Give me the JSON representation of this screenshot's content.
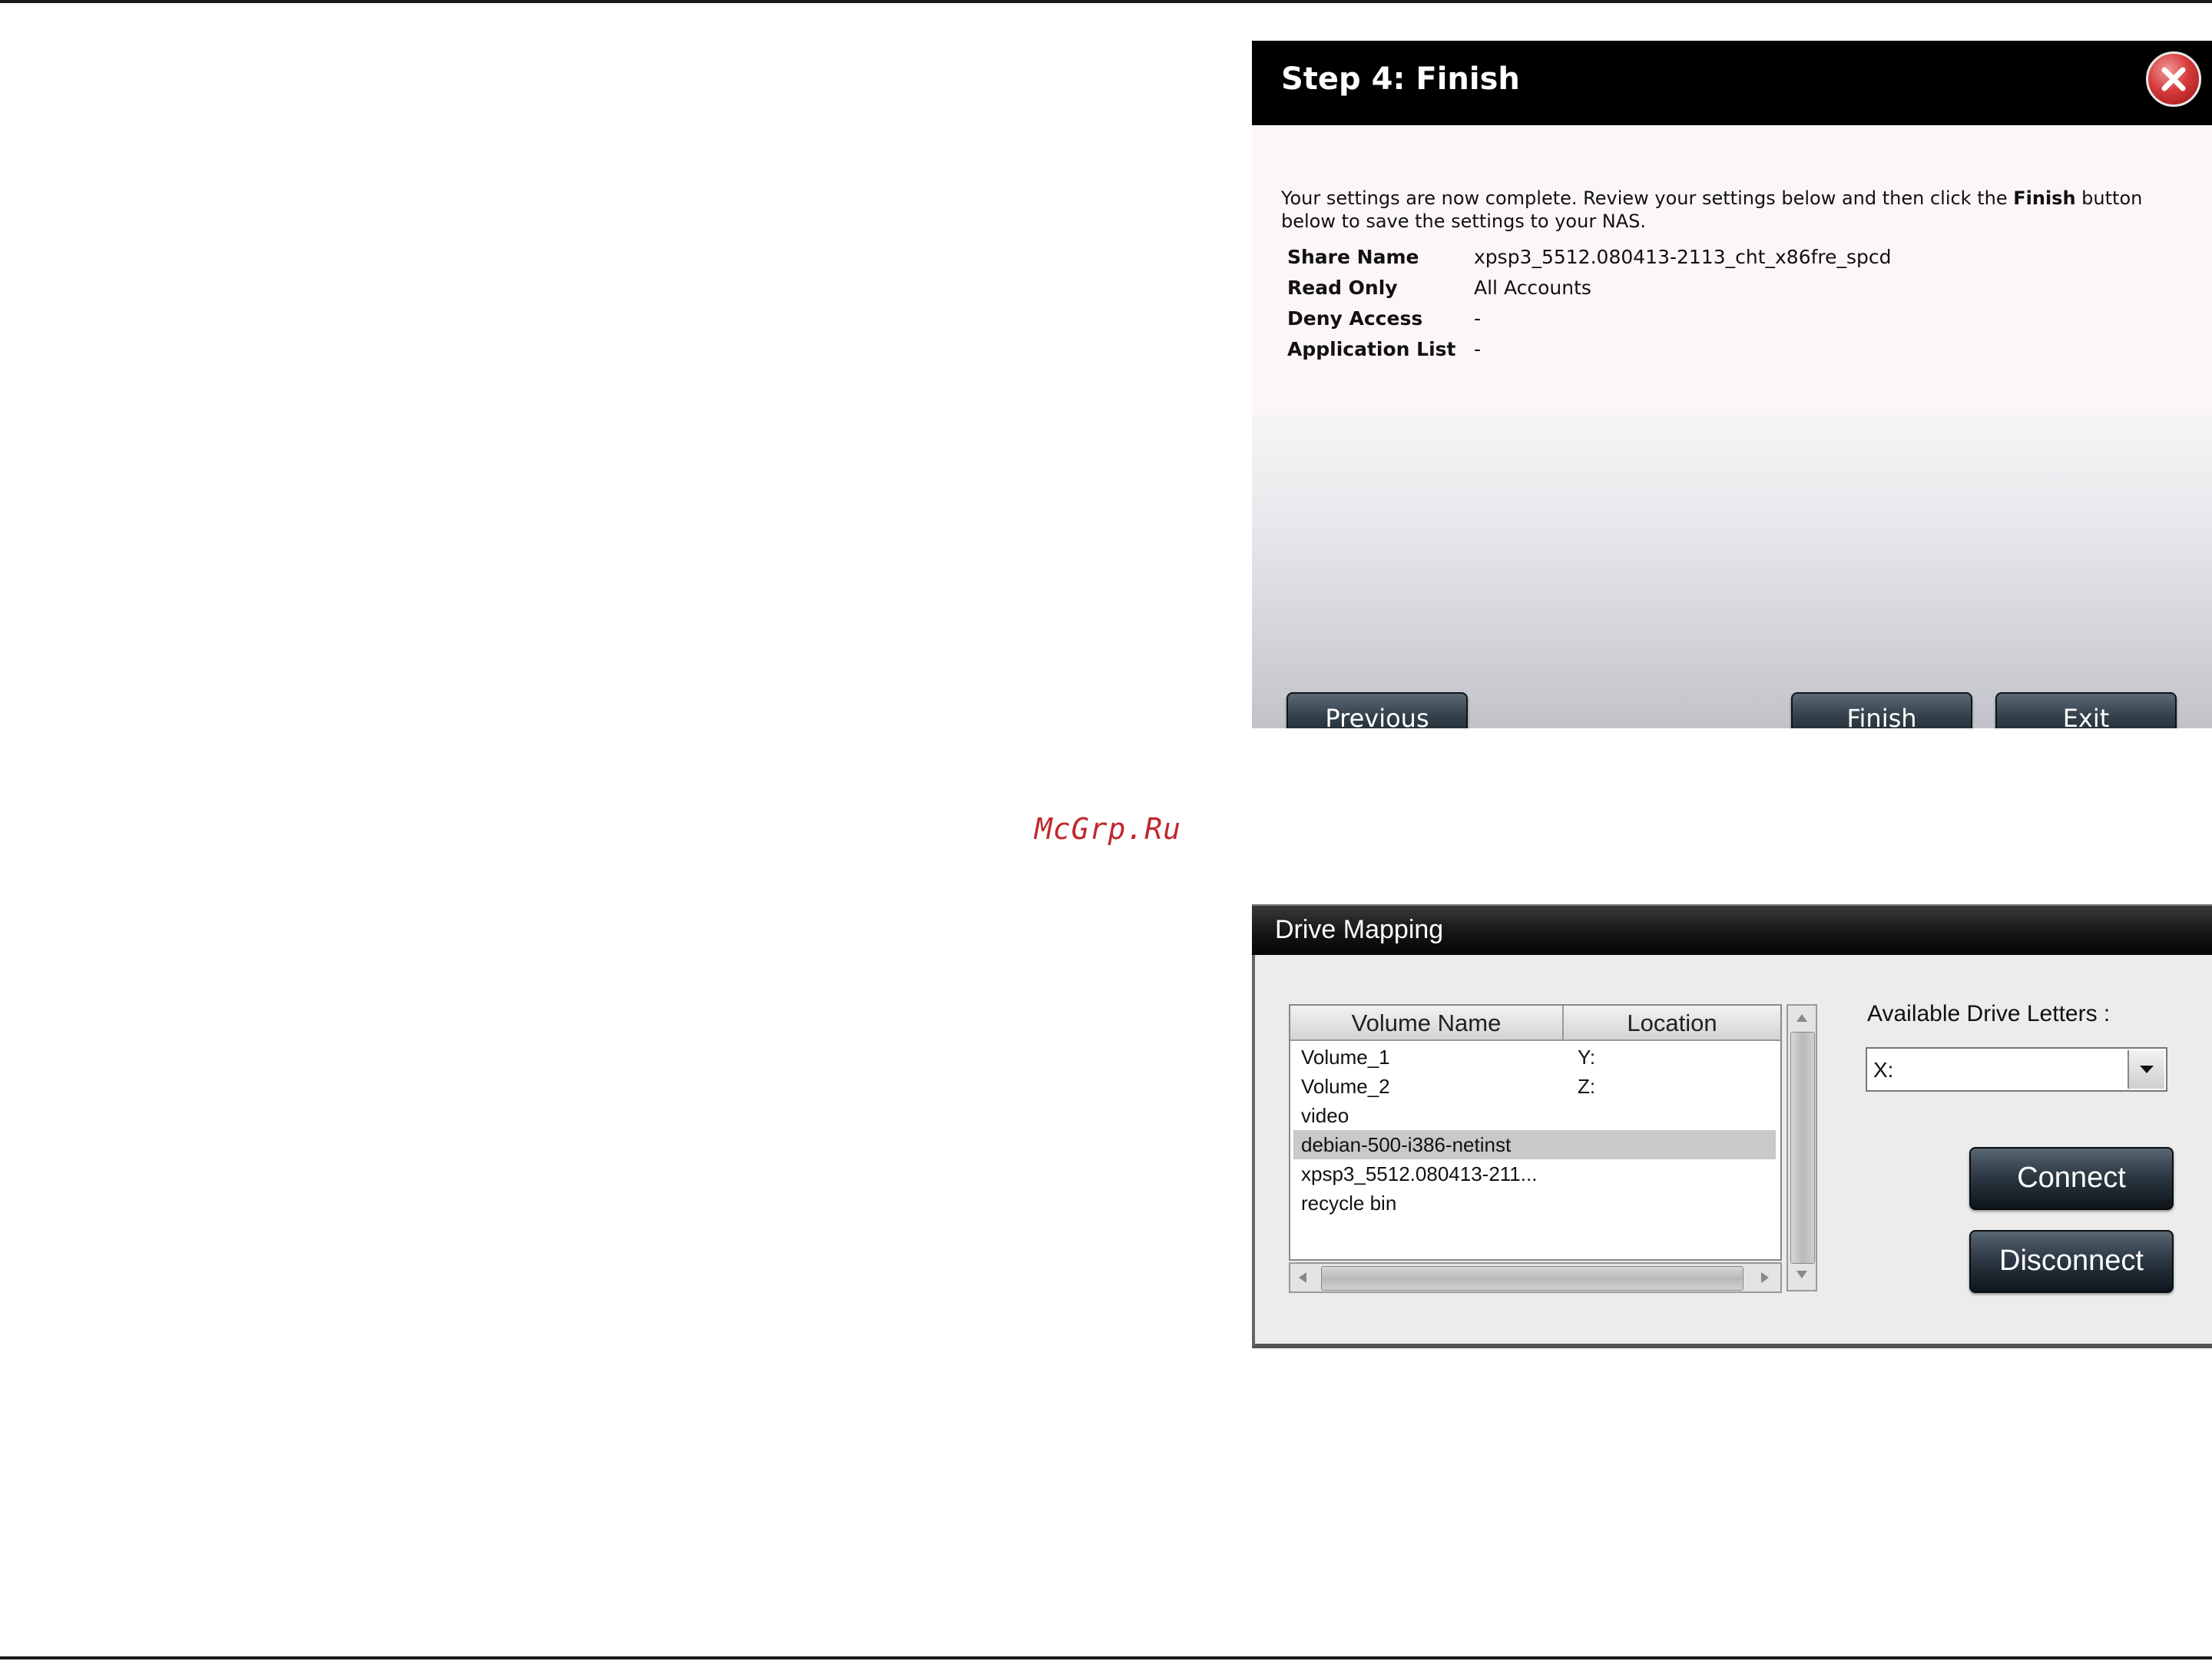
{
  "finish_dialog": {
    "title": "Step 4: Finish",
    "intro_part1": "Your settings are now complete. Review your settings below and then click the ",
    "intro_bold": "Finish",
    "intro_part2": " button below to save the settings to your NAS.",
    "settings": [
      {
        "label": "Share Name",
        "value": "xpsp3_5512.080413-2113_cht_x86fre_spcd"
      },
      {
        "label": "Read Only",
        "value": "All Accounts"
      },
      {
        "label": "Deny Access",
        "value": "-"
      },
      {
        "label": "Application List",
        "value": "-"
      }
    ],
    "buttons": {
      "previous": "Previous",
      "finish": "Finish",
      "exit": "Exit"
    },
    "close_icon": "close-x-icon"
  },
  "watermark": "McGrp.Ru",
  "drive_mapping": {
    "title": "Drive Mapping",
    "columns": {
      "volume_name": "Volume Name",
      "location": "Location"
    },
    "rows": [
      {
        "name": "Volume_1",
        "location": "Y:"
      },
      {
        "name": "Volume_2",
        "location": "Z:"
      },
      {
        "name": "video",
        "location": ""
      },
      {
        "name": "debian-500-i386-netinst",
        "location": ""
      },
      {
        "name": "xpsp3_5512.080413-211...",
        "location": ""
      },
      {
        "name": "recycle bin",
        "location": ""
      }
    ],
    "selected_row": 3,
    "available_label": "Available Drive Letters :",
    "drive_letter": "X:",
    "buttons": {
      "connect": "Connect",
      "disconnect": "Disconnect"
    }
  }
}
